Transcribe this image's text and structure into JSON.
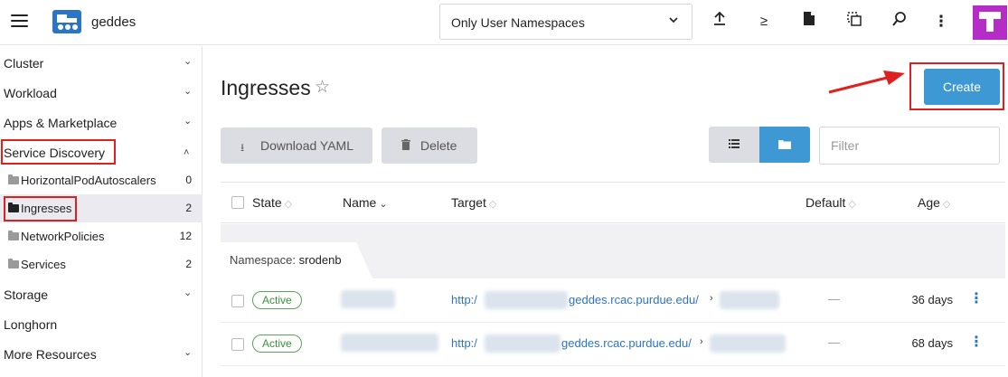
{
  "header": {
    "cluster_name": "geddes",
    "namespace_filter": "Only User Namespaces",
    "icons": [
      "menu-icon",
      "cluster-logo-icon",
      "upload-icon",
      "shell-icon",
      "file-icon",
      "copy-config-icon",
      "search-icon",
      "more-icon",
      "user-avatar"
    ]
  },
  "sidebar": {
    "groups": [
      {
        "label": "Cluster",
        "expanded": false
      },
      {
        "label": "Workload",
        "expanded": false
      },
      {
        "label": "Apps & Marketplace",
        "expanded": false
      },
      {
        "label": "Service Discovery",
        "expanded": true
      },
      {
        "label": "Storage",
        "expanded": false
      },
      {
        "label": "Longhorn",
        "expanded": false
      },
      {
        "label": "More Resources",
        "expanded": false
      }
    ],
    "service_discovery_items": [
      {
        "label": "HorizontalPodAutoscalers",
        "count": "0"
      },
      {
        "label": "Ingresses",
        "count": "2",
        "active": true
      },
      {
        "label": "NetworkPolicies",
        "count": "12"
      },
      {
        "label": "Services",
        "count": "2"
      }
    ]
  },
  "main": {
    "title": "Ingresses",
    "create_label": "Create",
    "download_yaml_label": "Download YAML",
    "delete_label": "Delete",
    "filter_placeholder": "Filter",
    "columns": [
      "State",
      "Name",
      "Target",
      "Default",
      "Age"
    ],
    "group_prefix": "Namespace:",
    "group_namespace": "srodenb",
    "rows": [
      {
        "state": "Active",
        "target_prefix": "http:/",
        "target_suffix": "geddes.rcac.purdue.edu/",
        "default": "—",
        "age": "36 days"
      },
      {
        "state": "Active",
        "target_prefix": "http:/",
        "target_suffix": "geddes.rcac.purdue.edu/",
        "default": "—",
        "age": "68 days"
      }
    ]
  },
  "colors": {
    "primary": "#3d98d3",
    "annotation_red": "#e02020",
    "active_badge": "#3d8f3d",
    "avatar": "#b52cc7"
  }
}
